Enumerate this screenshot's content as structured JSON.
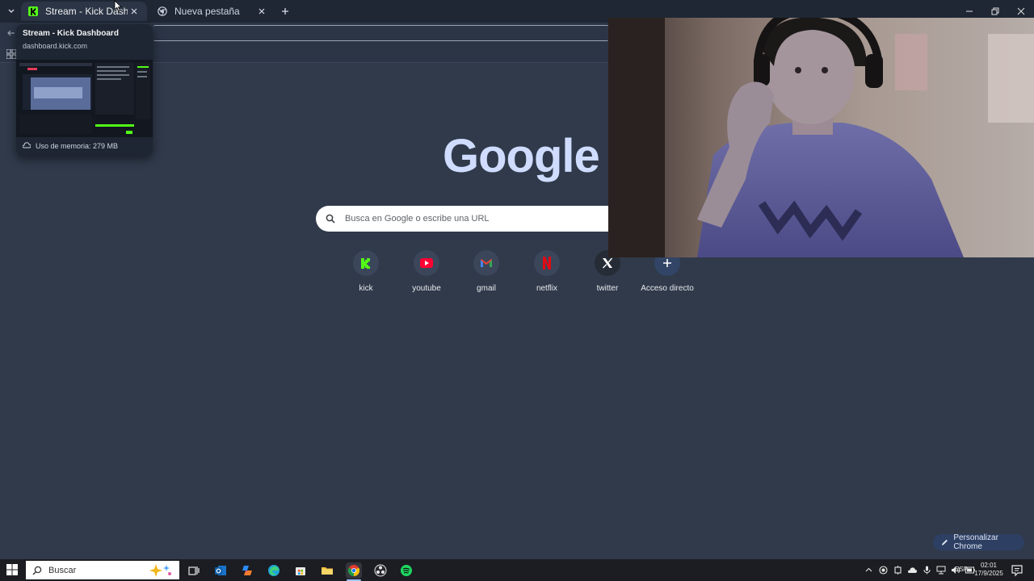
{
  "browser": {
    "tabs": [
      {
        "title": "Stream - Kick Dashboard",
        "active": true,
        "favicon": "kick-icon"
      },
      {
        "title": "Nueva pestaña",
        "active": false,
        "favicon": "chrome-icon"
      }
    ],
    "hover_card": {
      "title": "Stream - Kick Dashboard",
      "domain": "dashboard.kick.com",
      "memory": "Uso de memoria: 279 MB"
    }
  },
  "newtab": {
    "logo": "Google",
    "search_placeholder": "Busca en Google o escribe una URL",
    "shortcuts": [
      {
        "label": "kick",
        "icon": "kick-icon",
        "color": "#53fc18"
      },
      {
        "label": "youtube",
        "icon": "youtube-icon",
        "color": "#ff0033"
      },
      {
        "label": "gmail",
        "icon": "gmail-icon",
        "color": "#ea4335"
      },
      {
        "label": "netflix",
        "icon": "netflix-icon",
        "color": "#e50914"
      },
      {
        "label": "twitter",
        "icon": "x-icon",
        "color": "#ffffff"
      },
      {
        "label": "Acceso directo",
        "icon": "plus-icon",
        "color": "#ffffff"
      }
    ],
    "customize_label": "Personalizar Chrome"
  },
  "taskbar": {
    "search_placeholder": "Buscar",
    "language": "ESP",
    "time": "02:01",
    "date": "17/9/2025"
  },
  "colors": {
    "page_bg": "#303a4b",
    "tabstrip_bg": "#1f2734",
    "accent_blue": "#cfdcff",
    "taskbar_bg": "#1c1d22"
  }
}
